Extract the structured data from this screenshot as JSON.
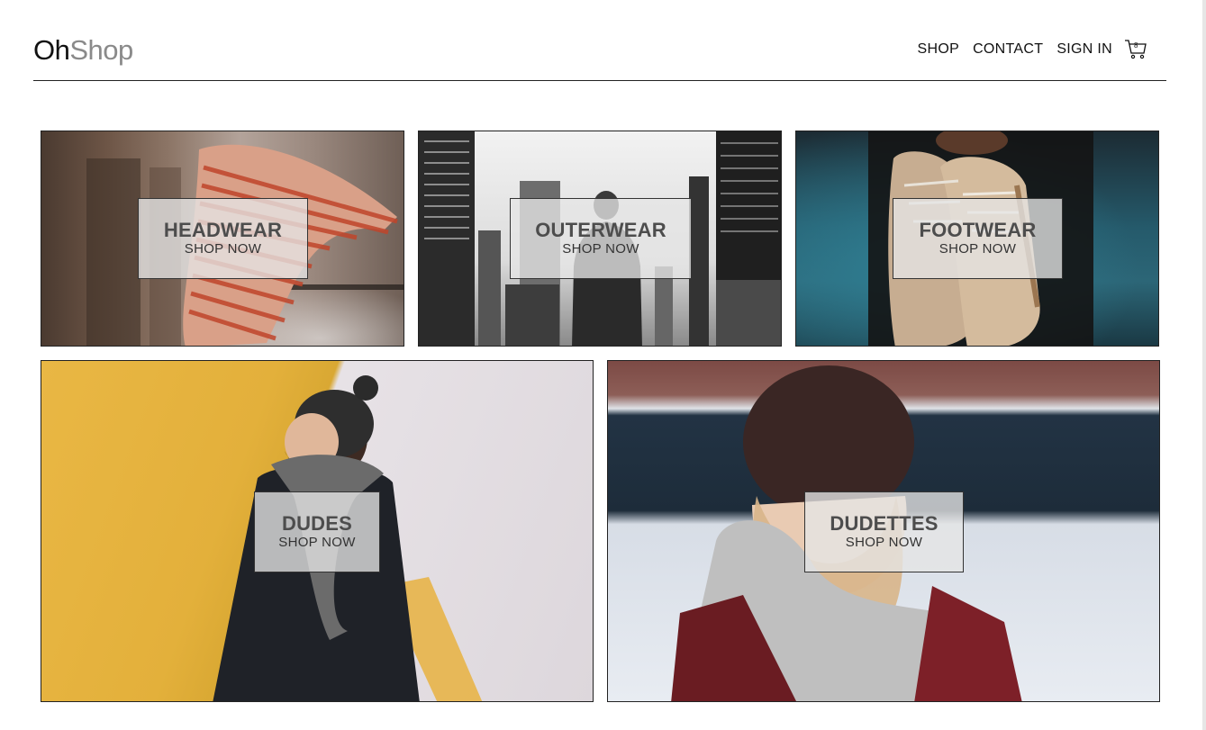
{
  "brand": {
    "part1": "Oh",
    "part2": "Shop"
  },
  "nav": {
    "items": [
      {
        "label": "SHOP"
      },
      {
        "label": "CONTACT"
      },
      {
        "label": "SIGN IN"
      }
    ]
  },
  "cart": {
    "count": "8"
  },
  "categories": [
    {
      "title": "HEADWEAR",
      "cta": "SHOP NOW"
    },
    {
      "title": "OUTERWEAR",
      "cta": "SHOP NOW"
    },
    {
      "title": "FOOTWEAR",
      "cta": "SHOP NOW"
    },
    {
      "title": "DUDES",
      "cta": "SHOP NOW"
    },
    {
      "title": "DUDETTES",
      "cta": "SHOP NOW"
    }
  ]
}
